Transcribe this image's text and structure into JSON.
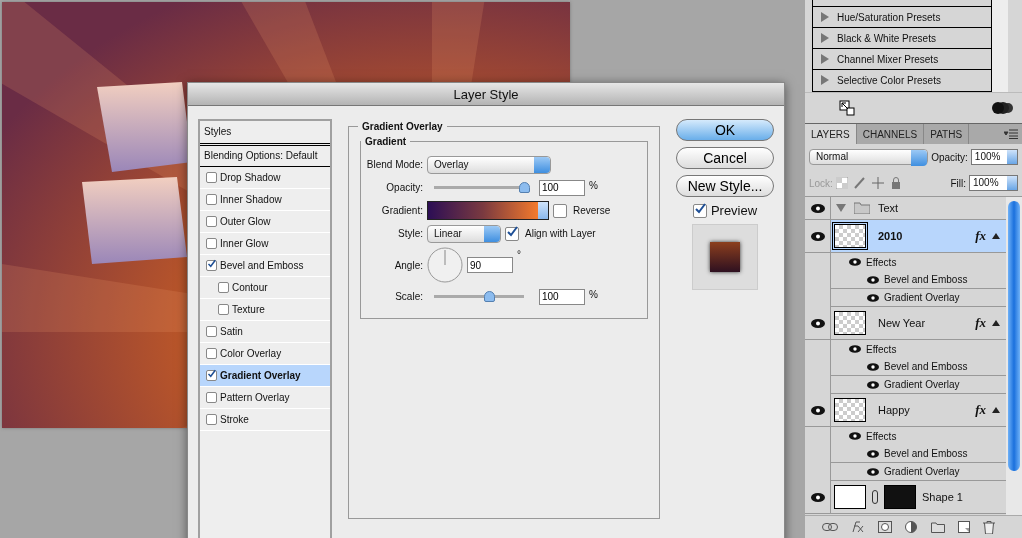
{
  "dialog": {
    "title": "Layer Style",
    "styles_header": "Styles",
    "blending_options": "Blending Options: Default",
    "styles": [
      {
        "label": "Drop Shadow",
        "checked": false,
        "selected": false
      },
      {
        "label": "Inner Shadow",
        "checked": false,
        "selected": false
      },
      {
        "label": "Outer Glow",
        "checked": false,
        "selected": false
      },
      {
        "label": "Inner Glow",
        "checked": false,
        "selected": false
      },
      {
        "label": "Bevel and Emboss",
        "checked": true,
        "selected": false,
        "children": [
          {
            "label": "Contour",
            "checked": false,
            "selected": false
          },
          {
            "label": "Texture",
            "checked": false,
            "selected": false
          }
        ]
      },
      {
        "label": "Satin",
        "checked": false,
        "selected": false
      },
      {
        "label": "Color Overlay",
        "checked": false,
        "selected": false
      },
      {
        "label": "Gradient Overlay",
        "checked": true,
        "selected": true
      },
      {
        "label": "Pattern Overlay",
        "checked": false,
        "selected": false
      },
      {
        "label": "Stroke",
        "checked": false,
        "selected": false
      }
    ],
    "section_title": "Gradient Overlay",
    "group_title": "Gradient",
    "blend_mode": {
      "label": "Blend Mode:",
      "value": "Overlay"
    },
    "opacity": {
      "label": "Opacity:",
      "level": 1.0,
      "value": "100",
      "unit": "%"
    },
    "gradient": {
      "label": "Gradient:"
    },
    "reverse": {
      "label": "Reverse",
      "checked": false
    },
    "style": {
      "label": "Style:",
      "value": "Linear"
    },
    "align": {
      "label": "Align with Layer",
      "checked": true
    },
    "angle": {
      "label": "Angle:",
      "value": "90",
      "unit": "°"
    },
    "scale": {
      "label": "Scale:",
      "level": 0.61,
      "value": "100",
      "unit": "%"
    },
    "buttons": [
      {
        "label": "OK",
        "primary": true
      },
      {
        "label": "Cancel",
        "primary": false
      },
      {
        "label": "New Style...",
        "primary": false
      }
    ],
    "preview": {
      "label": "Preview",
      "checked": true
    }
  },
  "presets": [
    "Hue/Saturation Presets",
    "Black & White Presets",
    "Channel Mixer Presets",
    "Selective Color Presets"
  ],
  "layers_panel": {
    "tabs": [
      {
        "label": "LAYERS",
        "selected": true
      },
      {
        "label": "CHANNELS",
        "selected": false
      },
      {
        "label": "PATHS",
        "selected": false
      }
    ],
    "blend_mode": "Normal",
    "opacity_label": "Opacity:",
    "opacity": "100%",
    "lock_label": "Lock:",
    "fill_label": "Fill:",
    "fill": "100%",
    "layers": [
      {
        "kind": "group",
        "name": "Text",
        "expanded": true,
        "selected": false
      },
      {
        "kind": "text",
        "name": "2010",
        "selected": true,
        "fx": "fx",
        "effects_expanded": true,
        "effects_label": "Effects",
        "effects": [
          "Bevel and Emboss",
          "Gradient Overlay"
        ]
      },
      {
        "kind": "text",
        "name": "New Year",
        "selected": false,
        "fx": "fx",
        "effects_expanded": true,
        "effects_label": "Effects",
        "effects": [
          "Bevel and Emboss",
          "Gradient Overlay"
        ]
      },
      {
        "kind": "text",
        "name": "Happy",
        "selected": false,
        "fx": "fx",
        "effects_expanded": true,
        "effects_label": "Effects",
        "effects": [
          "Bevel and Emboss",
          "Gradient Overlay"
        ]
      },
      {
        "kind": "shape",
        "name": "Shape 1",
        "selected": false
      }
    ]
  }
}
